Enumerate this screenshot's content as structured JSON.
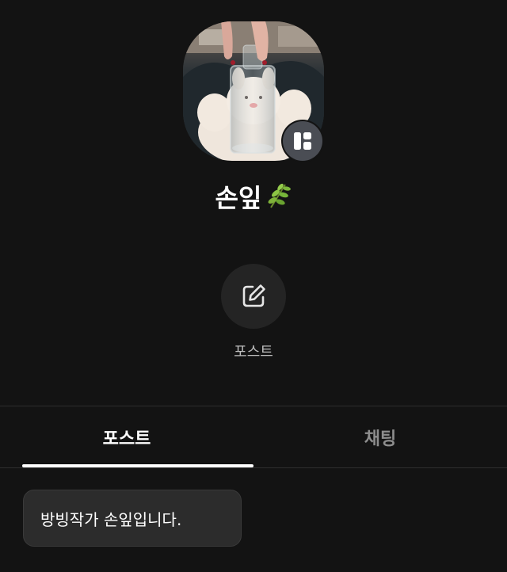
{
  "profile": {
    "name": "손잎",
    "name_emoji": "🌿",
    "avatar_alt": "profile photo",
    "badge_icon": "channel-grid-icon"
  },
  "actions": [
    {
      "label": "포스트",
      "icon": "edit-icon"
    }
  ],
  "tabs": [
    {
      "label": "포스트",
      "active": true
    },
    {
      "label": "채팅",
      "active": false
    }
  ],
  "posts": [
    {
      "text": "방빙작가 손잎입니다."
    }
  ],
  "colors": {
    "background": "#131313",
    "text": "#ffffff",
    "muted": "#8d8d8d",
    "bubble": "#2c2c2c",
    "badge": "#4a4d54"
  }
}
